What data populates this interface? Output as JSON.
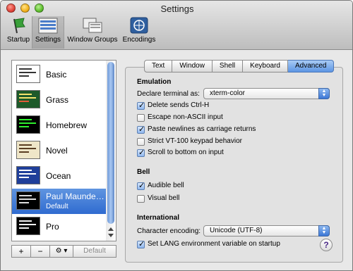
{
  "window": {
    "title": "Settings"
  },
  "toolbar": {
    "items": [
      {
        "label": "Startup",
        "icon": "startup-flag-icon",
        "selected": false
      },
      {
        "label": "Settings",
        "icon": "settings-icon",
        "selected": true
      },
      {
        "label": "Window Groups",
        "icon": "window-groups-icon",
        "selected": false
      },
      {
        "label": "Encodings",
        "icon": "globe-encodings-icon",
        "selected": false
      }
    ]
  },
  "profiles": {
    "items": [
      {
        "name": "Basic",
        "sub": ""
      },
      {
        "name": "Grass",
        "sub": ""
      },
      {
        "name": "Homebrew",
        "sub": ""
      },
      {
        "name": "Novel",
        "sub": ""
      },
      {
        "name": "Ocean",
        "sub": ""
      },
      {
        "name": "Paul Maunde…",
        "sub": "Default"
      },
      {
        "name": "Pro",
        "sub": ""
      }
    ],
    "add_label": "+",
    "remove_label": "−",
    "action_label": "⚙ ▾",
    "default_label": "Default"
  },
  "tabs": [
    "Text",
    "Window",
    "Shell",
    "Keyboard",
    "Advanced"
  ],
  "emulation": {
    "heading": "Emulation",
    "declare_label": "Declare terminal as:",
    "declare_value": "xterm-color",
    "options": [
      {
        "label": "Delete sends Ctrl-H",
        "checked": true
      },
      {
        "label": "Escape non-ASCII input",
        "checked": false
      },
      {
        "label": "Paste newlines as carriage returns",
        "checked": true
      },
      {
        "label": "Strict VT-100 keypad behavior",
        "checked": false
      },
      {
        "label": "Scroll to bottom on input",
        "checked": true
      }
    ]
  },
  "bell": {
    "heading": "Bell",
    "options": [
      {
        "label": "Audible bell",
        "checked": true
      },
      {
        "label": "Visual bell",
        "checked": false
      }
    ]
  },
  "international": {
    "heading": "International",
    "encoding_label": "Character encoding:",
    "encoding_value": "Unicode (UTF-8)",
    "lang_label": "Set LANG environment variable on startup",
    "lang_checked": true
  },
  "help_label": "?",
  "colors": {
    "selection": "#3b77d6",
    "window_bg": "#e8e8e8"
  }
}
